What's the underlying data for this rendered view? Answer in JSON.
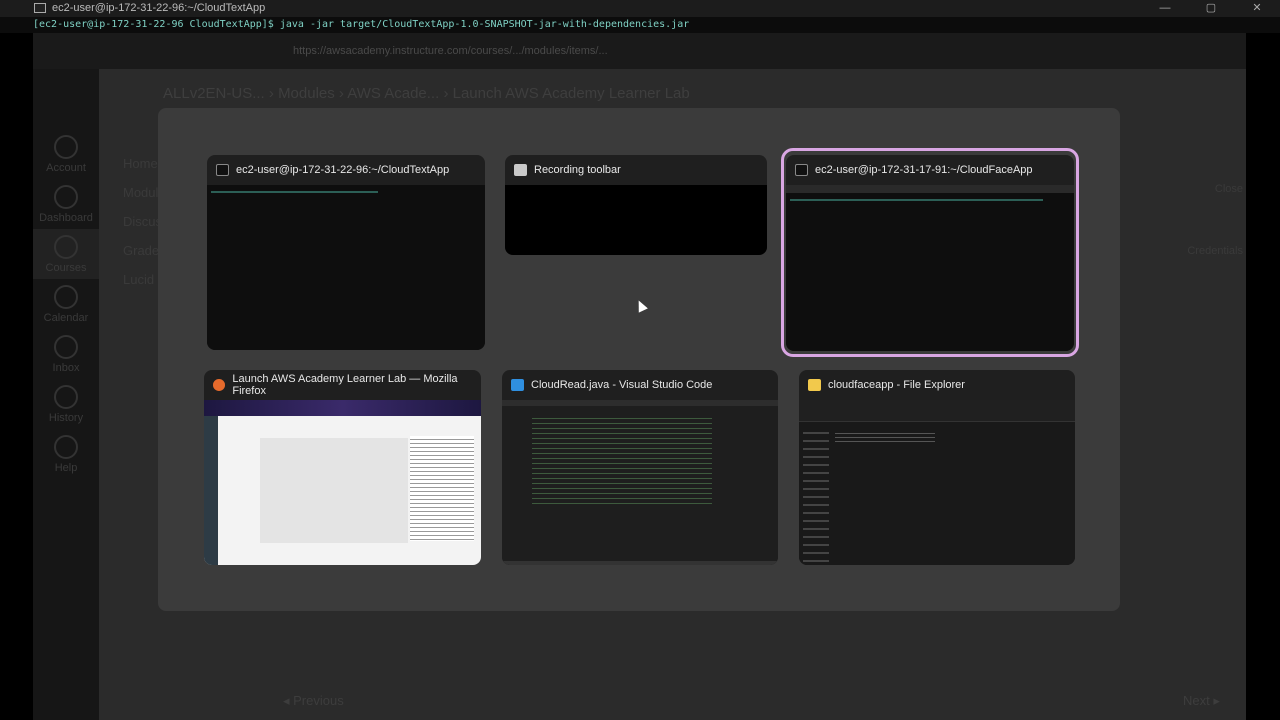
{
  "terminal_window": {
    "title": "ec2-user@ip-172-31-22-96:~/CloudTextApp",
    "command_line": "[ec2-user@ip-172-31-22-96 CloudTextApp]$ java -jar target/CloudTextApp-1.0-SNAPSHOT-jar-with-dependencies.jar",
    "controls": [
      "—",
      "▢",
      "✕"
    ]
  },
  "background_browser": {
    "url": "https://awsacademy.instructure.com/courses/.../modules/items/...",
    "breadcrumbs": [
      "ALLv2EN-US...",
      "Modules",
      "AWS Acade...",
      "Launch AWS Academy Learner Lab"
    ],
    "sidebar": [
      {
        "label": "Account",
        "icon": "account-icon"
      },
      {
        "label": "Dashboard",
        "icon": "dashboard-icon"
      },
      {
        "label": "Courses",
        "icon": "courses-icon",
        "active": true
      },
      {
        "label": "Calendar",
        "icon": "calendar-icon"
      },
      {
        "label": "Inbox",
        "icon": "inbox-icon"
      },
      {
        "label": "History",
        "icon": "history-icon"
      },
      {
        "label": "Help",
        "icon": "help-icon"
      }
    ],
    "course_nav": [
      "Home",
      "Modules",
      "Discussions",
      "Grades",
      "Lucid"
    ],
    "right_pane": {
      "close": "Close",
      "credentials": "Credentials"
    },
    "prev": "◂ Previous",
    "next": "Next ▸"
  },
  "task_switcher": {
    "windows": [
      {
        "title": "ec2-user@ip-172-31-22-96:~/CloudTextApp",
        "icon": "terminal-icon",
        "selected": false
      },
      {
        "title": "Recording toolbar",
        "icon": "recording-icon",
        "selected": false
      },
      {
        "title": "ec2-user@ip-172-31-17-91:~/CloudFaceApp",
        "icon": "terminal-icon",
        "selected": true
      },
      {
        "title": "Launch AWS Academy Learner Lab — Mozilla Firefox",
        "icon": "firefox-icon",
        "selected": false
      },
      {
        "title": "CloudRead.java - Visual Studio Code",
        "icon": "vscode-icon",
        "selected": false
      },
      {
        "title": "cloudfaceapp - File Explorer",
        "icon": "folder-icon",
        "selected": false
      }
    ],
    "selection_color": "#d9a6e3"
  }
}
